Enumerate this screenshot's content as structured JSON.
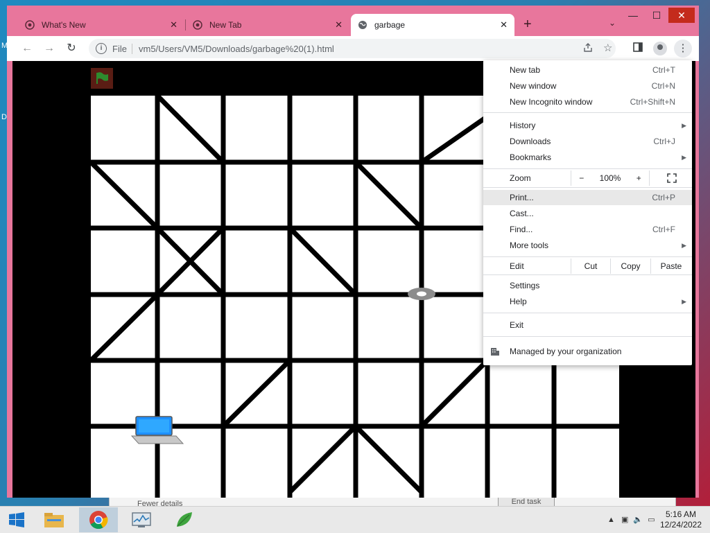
{
  "desktop": {
    "glyph_left_1": "M",
    "glyph_left_2": "D"
  },
  "background_window": {
    "text": "Fewer details",
    "button": "End task"
  },
  "window": {
    "controls": {
      "minimize": "—",
      "maximize": "☐",
      "close": "✕"
    },
    "tabs": [
      {
        "title": "What's New",
        "favicon": "chrome-icon",
        "active": false
      },
      {
        "title": "New Tab",
        "favicon": "chrome-icon",
        "active": false
      },
      {
        "title": "garbage",
        "favicon": "globe-icon",
        "active": true
      }
    ],
    "new_tab_label": "+",
    "tab_search_label": "⌄"
  },
  "toolbar": {
    "back": "←",
    "forward": "→",
    "reload": "↻",
    "scheme": "File",
    "url": "vm5/Users/VM5/Downloads/garbage%20(1).html",
    "info_icon": "i",
    "kebab": "⋮"
  },
  "menu": {
    "items": [
      {
        "label": "New tab",
        "shortcut": "Ctrl+T"
      },
      {
        "label": "New window",
        "shortcut": "Ctrl+N"
      },
      {
        "label": "New Incognito window",
        "shortcut": "Ctrl+Shift+N"
      },
      {
        "label": "History",
        "shortcut": ""
      },
      {
        "label": "Downloads",
        "shortcut": "Ctrl+J"
      },
      {
        "label": "Bookmarks",
        "shortcut": ""
      },
      {
        "label": "Print...",
        "shortcut": "Ctrl+P"
      },
      {
        "label": "Cast...",
        "shortcut": ""
      },
      {
        "label": "Find...",
        "shortcut": "Ctrl+F"
      },
      {
        "label": "More tools",
        "shortcut": ""
      },
      {
        "label": "Settings",
        "shortcut": ""
      },
      {
        "label": "Help",
        "shortcut": ""
      },
      {
        "label": "Exit",
        "shortcut": ""
      }
    ],
    "zoom": {
      "label": "Zoom",
      "minus": "−",
      "value": "100%",
      "plus": "+"
    },
    "edit": {
      "label": "Edit",
      "cut": "Cut",
      "copy": "Copy",
      "paste": "Paste"
    },
    "managed": "Managed by your organization",
    "highlighted": "Print..."
  },
  "taskbar": {
    "apps": [
      "file-explorer-icon",
      "chrome-icon",
      "task-manager-icon",
      "leaf-app-icon"
    ],
    "active_app": "chrome-icon",
    "time": "5:16 AM",
    "date": "12/24/2022"
  },
  "colors": {
    "titlebar": "#e8769c",
    "close": "#c42b1c",
    "laptop": "#1e90ff",
    "flag": "#2e8b2e"
  }
}
